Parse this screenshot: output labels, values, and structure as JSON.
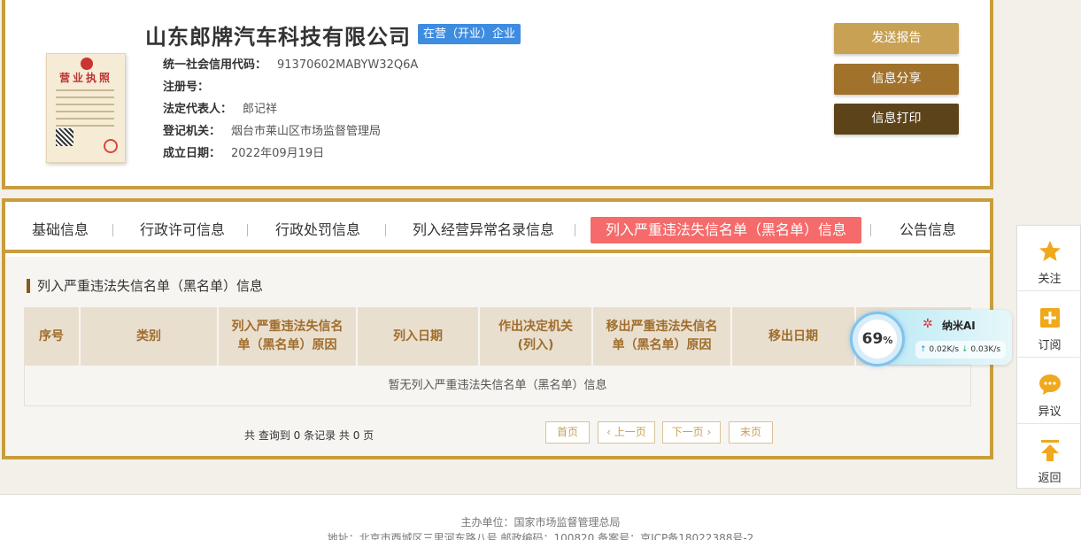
{
  "company": {
    "name": "山东郎牌汽车科技有限公司",
    "status": "在营（开业）企业",
    "license_image": {
      "title": "营业执照"
    },
    "fields": [
      {
        "label": "统一社会信用代码：",
        "value": "91370602MABYW32Q6A"
      },
      {
        "label": "注册号：",
        "value": ""
      },
      {
        "label": "法定代表人：",
        "value": "郎记祥"
      },
      {
        "label": "登记机关：",
        "value": "烟台市莱山区市场监督管理局"
      },
      {
        "label": "成立日期：",
        "value": "2022年09月19日"
      }
    ]
  },
  "actions": {
    "report": "发送报告",
    "share": "信息分享",
    "print": "信息打印"
  },
  "tabs": [
    {
      "label": "基础信息",
      "active": false
    },
    {
      "label": "行政许可信息",
      "active": false
    },
    {
      "label": "行政处罚信息",
      "active": false
    },
    {
      "label": "列入经营异常名录信息",
      "active": false
    },
    {
      "label": "列入严重违法失信名单（黑名单）信息",
      "active": true
    },
    {
      "label": "公告信息",
      "active": false
    }
  ],
  "section": {
    "title": "列入严重违法失信名单（黑名单）信息",
    "table": {
      "headers": [
        "序号",
        "类别",
        "列入严重违法失信名单（黑名单）原因",
        "列入日期",
        "作出决定机关(列入)",
        "移出严重违法失信名单（黑名单）原因",
        "移出日期"
      ],
      "empty_text": "暂无列入严重违法失信名单（黑名单）信息"
    },
    "record_count": "共 查询到 0 条记录 共 0 页",
    "pagination": {
      "first": "首页",
      "prev": "上一页",
      "next": "下一页",
      "last": "末页"
    }
  },
  "ai_widget": {
    "percent": "69",
    "percent_sign": "%",
    "name": "纳米AI",
    "upload": "0.02K/s",
    "download": "0.03K/s"
  },
  "sidebar": {
    "follow": "关注",
    "subscribe": "订阅",
    "objection": "异议",
    "back": "返回"
  },
  "footer": {
    "line1": "主办单位：国家市场监督管理总局",
    "line2": "地址：北京市西城区三里河东路八号 邮政编码：100820 备案号：京ICP备18022388号-2"
  },
  "colors": {
    "gold_border": "#c99d3c",
    "active_tab": "#f56a6a",
    "status_badge": "#3e8ce0",
    "btn_report": "#c8a155",
    "btn_share": "#a0722b",
    "btn_print": "#5d4319"
  }
}
